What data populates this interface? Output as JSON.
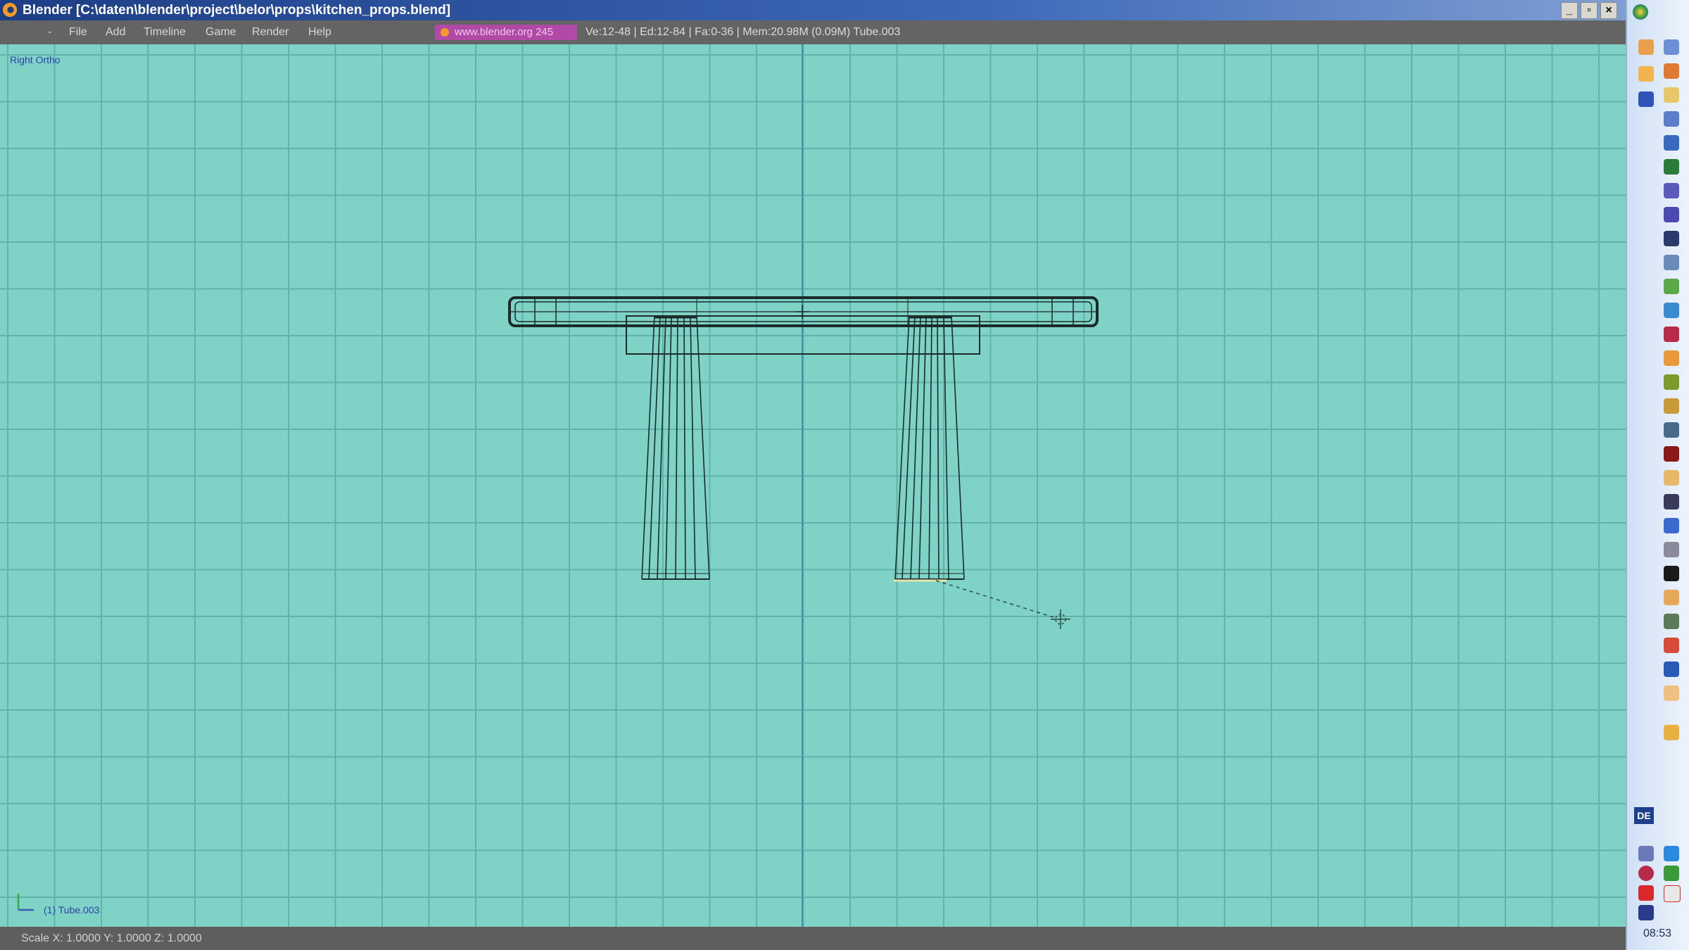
{
  "window": {
    "title": "Blender [C:\\daten\\blender\\project\\belor\\props\\kitchen_props.blend]",
    "minimize_label": "_",
    "maximize_label": "▫",
    "close_label": "×"
  },
  "menubar": {
    "dash": "-",
    "items": [
      {
        "label": "File"
      },
      {
        "label": "Add"
      },
      {
        "label": "Timeline"
      },
      {
        "label": "Game"
      },
      {
        "label": "Render"
      },
      {
        "label": "Help"
      }
    ],
    "url_badge": "www.blender.org 245",
    "stats": "Ve:12-48 | Ed:12-84 | Fa:0-36 | Mem:20.98M (0.09M) Tube.003"
  },
  "viewport": {
    "view_name": "Right Ortho",
    "active_object": "(1) Tube.003",
    "grid_color": "#60b3a9",
    "background_color": "#7fd3c6",
    "wire_color": "#1c2a2a"
  },
  "statusbar": {
    "text": "Scale X: 1.0000   Y: 1.0000   Z: 1.0000"
  },
  "taskbar": {
    "language": "DE",
    "clock": "08:53",
    "icons": [
      "start-orb-icon",
      "app-icon-1",
      "app-icon-2",
      "app-icon-3",
      "app-icon-4",
      "app-icon-5",
      "app-icon-6",
      "app-icon-7",
      "app-icon-8",
      "app-icon-9",
      "app-icon-10",
      "app-icon-11",
      "app-icon-12",
      "app-icon-13",
      "app-icon-14",
      "app-icon-15",
      "app-icon-16",
      "app-icon-17",
      "app-icon-18",
      "app-icon-19",
      "app-icon-20",
      "app-icon-21",
      "app-icon-22",
      "app-icon-23",
      "app-icon-24",
      "app-icon-25",
      "app-icon-26",
      "app-icon-27",
      "app-icon-28",
      "app-icon-29",
      "app-icon-30"
    ]
  }
}
